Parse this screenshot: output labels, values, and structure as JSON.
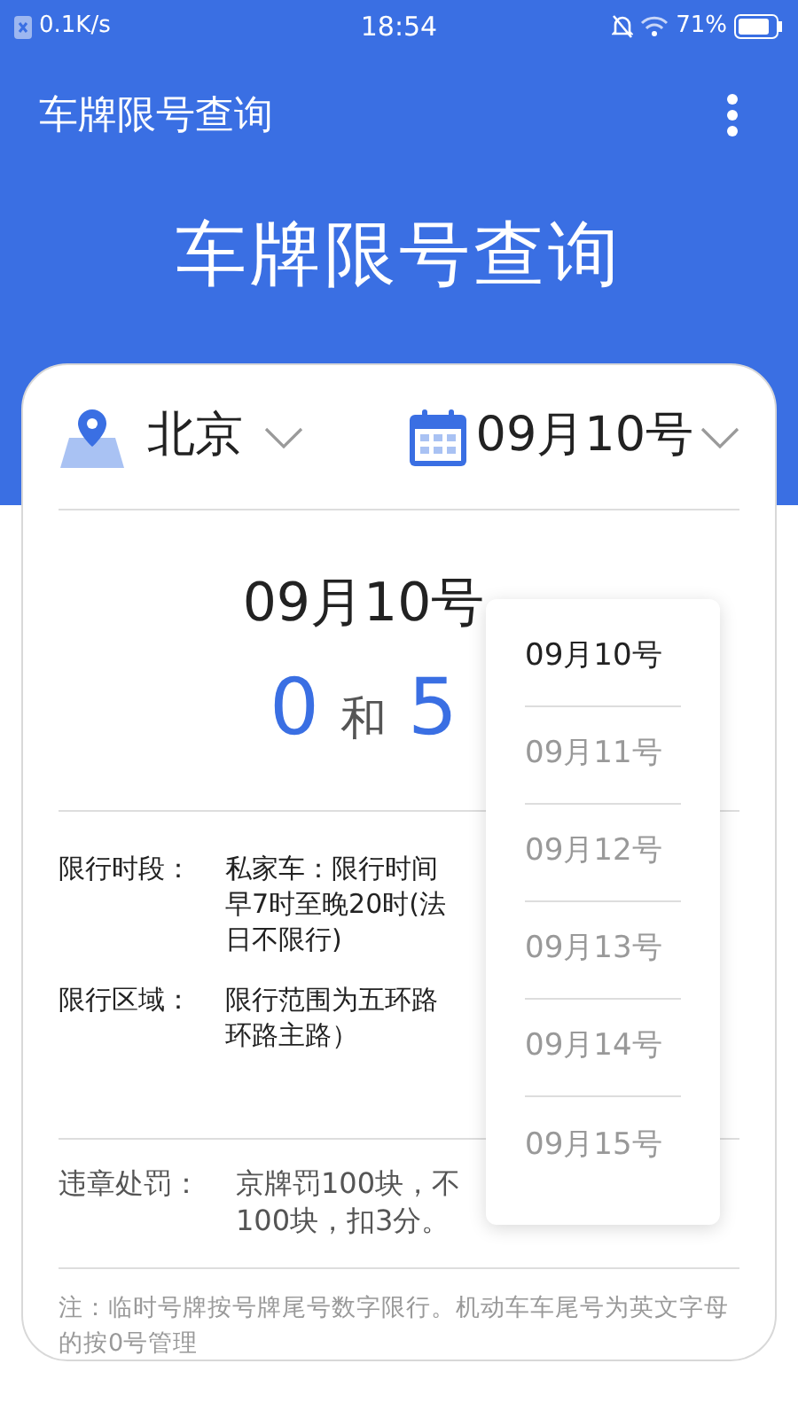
{
  "status_bar": {
    "speed": "0.1K/s",
    "time": "18:54",
    "battery": "71%"
  },
  "toolbar": {
    "title": "车牌限号查询"
  },
  "hero": {
    "title": "车牌限号查询"
  },
  "selector": {
    "city": "北京",
    "date": "09月10号"
  },
  "result": {
    "title": "09月10号",
    "first": "0",
    "joiner": "和",
    "second": "5"
  },
  "details": [
    {
      "label": "限行时段：",
      "lines": [
        "私家车：限行时间",
        "早7时至晚20时(法",
        "日不限行)"
      ]
    },
    {
      "label": "限行区域：",
      "lines": [
        "限行范围为五环路",
        "环路主路）"
      ]
    }
  ],
  "penalty": {
    "label": "违章处罚：",
    "lines": [
      "京牌罚100块，不",
      "100块，扣3分。"
    ]
  },
  "note": "注：临时号牌按号牌尾号数字限行。机动车车尾号为英文字母的按0号管理",
  "dropdown": [
    {
      "label": "09月10号",
      "selected": true
    },
    {
      "label": "09月11号",
      "selected": false
    },
    {
      "label": "09月12号",
      "selected": false
    },
    {
      "label": "09月13号",
      "selected": false
    },
    {
      "label": "09月14号",
      "selected": false
    },
    {
      "label": "09月15号",
      "selected": false
    }
  ]
}
